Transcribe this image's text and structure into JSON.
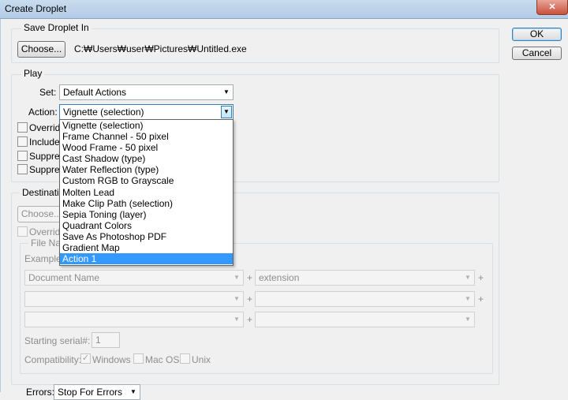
{
  "window": {
    "title": "Create Droplet",
    "close_glyph": "✕"
  },
  "buttons": {
    "ok": "OK",
    "cancel": "Cancel"
  },
  "save_droplet": {
    "legend": "Save Droplet In",
    "choose_label": "Choose...",
    "path": "C:₩Users₩user₩Pictures₩Untitled.exe"
  },
  "play": {
    "legend": "Play",
    "set_label": "Set:",
    "set_value": "Default Actions",
    "action_label": "Action:",
    "action_value": "Vignette (selection)",
    "checkboxes": [
      "Override",
      "Include",
      "Suppres",
      "Suppres"
    ],
    "action_options": [
      "Vignette (selection)",
      "Frame Channel - 50 pixel",
      "Wood Frame - 50 pixel",
      "Cast Shadow (type)",
      "Water Reflection (type)",
      "Custom RGB to Grayscale",
      "Molten Lead",
      "Make Clip Path (selection)",
      "Sepia Toning (layer)",
      "Quadrant Colors",
      "Save As Photoshop PDF",
      "Gradient Map",
      "Action 1"
    ],
    "highlighted_option": "Action 1"
  },
  "destination": {
    "legend": "Destinatio",
    "choose_label": "Choose...",
    "override_label": "Override",
    "file_naming_legend": "File Nan",
    "example_label": "Example:",
    "rows": [
      {
        "left": "Document Name",
        "right": "extension"
      },
      {
        "left": "",
        "right": ""
      },
      {
        "left": "",
        "right": ""
      }
    ],
    "plus": "+",
    "starting_serial_label": "Starting serial#:",
    "starting_serial_value": "1",
    "compatibility_label": "Compatibility:",
    "compat_windows": "Windows",
    "compat_mac": "Mac OS",
    "compat_unix": "Unix"
  },
  "errors": {
    "label": "Errors:",
    "value": "Stop For Errors"
  },
  "icons": {
    "dropdown_arrow": "▼",
    "check": "✓"
  }
}
